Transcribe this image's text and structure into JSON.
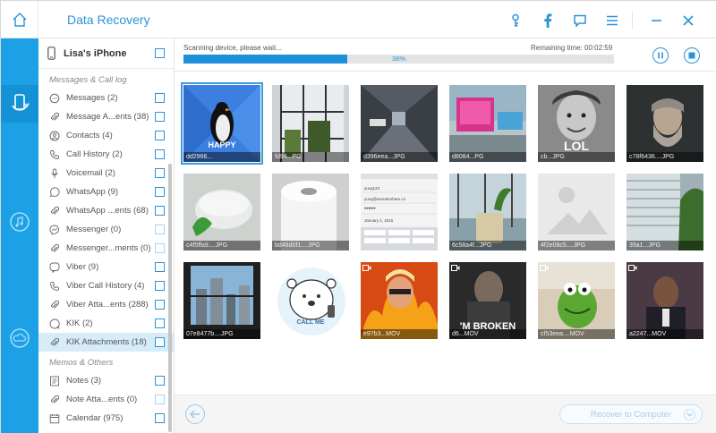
{
  "app": {
    "title": "Data Recovery"
  },
  "device": {
    "name": "Lisa's iPhone"
  },
  "sections": {
    "messages": "Messages & Call log",
    "memos": "Memos & Others"
  },
  "items": [
    {
      "label": "Messages (2)",
      "icon": "chat-bubble-icon"
    },
    {
      "label": "Message A...ents (38)",
      "icon": "paperclip-icon"
    },
    {
      "label": "Contacts (4)",
      "icon": "person-icon"
    },
    {
      "label": "Call History (2)",
      "icon": "phone-icon"
    },
    {
      "label": "Voicemail (2)",
      "icon": "microphone-icon"
    },
    {
      "label": "WhatsApp (9)",
      "icon": "whatsapp-icon"
    },
    {
      "label": "WhatsApp ...ents (68)",
      "icon": "paperclip-icon"
    },
    {
      "label": "Messenger (0)",
      "icon": "messenger-icon"
    },
    {
      "label": "Messenger...ments (0)",
      "icon": "paperclip-icon"
    },
    {
      "label": "Viber (9)",
      "icon": "viber-icon"
    },
    {
      "label": "Viber Call History (4)",
      "icon": "phone-icon"
    },
    {
      "label": "Viber Atta...ents (288)",
      "icon": "paperclip-icon"
    },
    {
      "label": "KIK (2)",
      "icon": "kik-icon"
    },
    {
      "label": "KIK Attachments (18)",
      "icon": "paperclip-icon"
    }
  ],
  "memo_items": [
    {
      "label": "Notes (3)",
      "icon": "note-icon"
    },
    {
      "label": "Note Atta...ents (0)",
      "icon": "paperclip-icon"
    },
    {
      "label": "Calendar (975)",
      "icon": "calendar-icon"
    }
  ],
  "scan": {
    "status": "Scanning device, please wait...",
    "remaining": "Remaining time: 00:02:59",
    "progress_label": "38%",
    "progress": 0.38
  },
  "thumbnails": [
    {
      "caption": "dd2966...",
      "kind": "image"
    },
    {
      "caption": "fd94...PG",
      "kind": "image"
    },
    {
      "caption": "d396eea...JPG",
      "kind": "image"
    },
    {
      "caption": "d8084...PG",
      "kind": "image"
    },
    {
      "caption": "cb...JPG",
      "kind": "image"
    },
    {
      "caption": "c78f6436....JPG",
      "kind": "image"
    },
    {
      "caption": "c4f5ffa9....JPG",
      "kind": "image"
    },
    {
      "caption": "bd48d0f1....JPG",
      "kind": "image"
    },
    {
      "caption": "",
      "kind": "image"
    },
    {
      "caption": "6c58a4f...JPG",
      "kind": "image"
    },
    {
      "caption": "4f2e08c5....JPG",
      "kind": "image"
    },
    {
      "caption": "39a1...JPG",
      "kind": "image"
    },
    {
      "caption": "07e8477b....JPG",
      "kind": "image"
    },
    {
      "caption": "",
      "kind": "image"
    },
    {
      "caption": "e97b3...MOV",
      "kind": "video"
    },
    {
      "caption": "d6...MOV",
      "kind": "video"
    },
    {
      "caption": "cf53eea....MOV",
      "kind": "video"
    },
    {
      "caption": "a2247...MOV",
      "kind": "video"
    }
  ],
  "thumb_text": {
    "happy": "HAPPY",
    "lol": "LOL",
    "call_me": "CALL ME",
    "broken": "'M BROKEN"
  },
  "login_form": {
    "user": "yuxq123",
    "email": "yuxq@wondershare.cn",
    "dots": "••••••",
    "date": "January 1, 2016"
  },
  "bottom": {
    "recover_label": "Recover to Computer"
  },
  "colors": {
    "accent": "#1ca1e6",
    "title": "#2a93d8"
  }
}
